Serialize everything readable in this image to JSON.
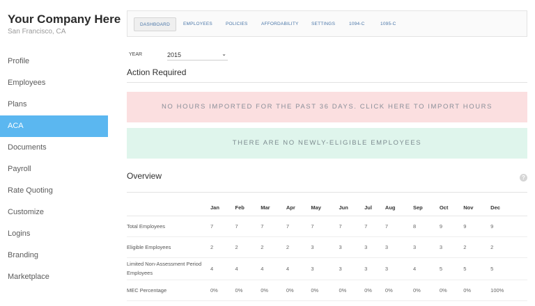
{
  "company": {
    "name": "Your Company Here",
    "location": "San Francisco, CA"
  },
  "sidebar": {
    "items": [
      {
        "label": "Profile"
      },
      {
        "label": "Employees"
      },
      {
        "label": "Plans"
      },
      {
        "label": "ACA"
      },
      {
        "label": "Documents"
      },
      {
        "label": "Payroll"
      },
      {
        "label": "Rate Quoting"
      },
      {
        "label": "Customize"
      },
      {
        "label": "Logins"
      },
      {
        "label": "Branding"
      },
      {
        "label": "Marketplace"
      }
    ],
    "active_item": "ACA"
  },
  "tabs": [
    {
      "label": "DASHBOARD"
    },
    {
      "label": "EMPLOYEES"
    },
    {
      "label": "POLICIES"
    },
    {
      "label": "AFFORDABILITY"
    },
    {
      "label": "SETTINGS"
    },
    {
      "label": "1094-C"
    },
    {
      "label": "1095-C"
    }
  ],
  "active_tab": "DASHBOARD",
  "year": {
    "label": "YEAR",
    "value": "2015"
  },
  "action_required": {
    "title": "Action Required",
    "alert_hours": "NO HOURS IMPORTED FOR THE PAST 36 DAYS. CLICK HERE TO IMPORT HOURS",
    "alert_eligible": "THERE ARE NO NEWLY-ELIGIBLE EMPLOYEES"
  },
  "overview": {
    "title": "Overview",
    "help": "?",
    "months": [
      "Jan",
      "Feb",
      "Mar",
      "Apr",
      "May",
      "Jun",
      "Jul",
      "Aug",
      "Sep",
      "Oct",
      "Nov",
      "Dec"
    ],
    "rows": [
      {
        "label": "Total Employees",
        "values": [
          "7",
          "7",
          "7",
          "7",
          "7",
          "7",
          "7",
          "7",
          "8",
          "9",
          "9",
          "9"
        ]
      },
      {
        "label": "Eligible Employees",
        "values": [
          "2",
          "2",
          "2",
          "2",
          "3",
          "3",
          "3",
          "3",
          "3",
          "3",
          "2",
          "2"
        ]
      },
      {
        "label": "Limited Non-Assessment Period Employees",
        "values": [
          "4",
          "4",
          "4",
          "4",
          "3",
          "3",
          "3",
          "3",
          "4",
          "5",
          "5",
          "5"
        ]
      },
      {
        "label": "MEC Percentage",
        "values": [
          "0%",
          "0%",
          "0%",
          "0%",
          "0%",
          "0%",
          "0%",
          "0%",
          "0%",
          "0%",
          "0%",
          "100%"
        ]
      }
    ]
  },
  "colors": {
    "active_nav": "#5bb7f0",
    "alert_red_bg": "#fbdfe0",
    "alert_green_bg": "#dff5ec",
    "tab_text": "#4a76a8"
  }
}
